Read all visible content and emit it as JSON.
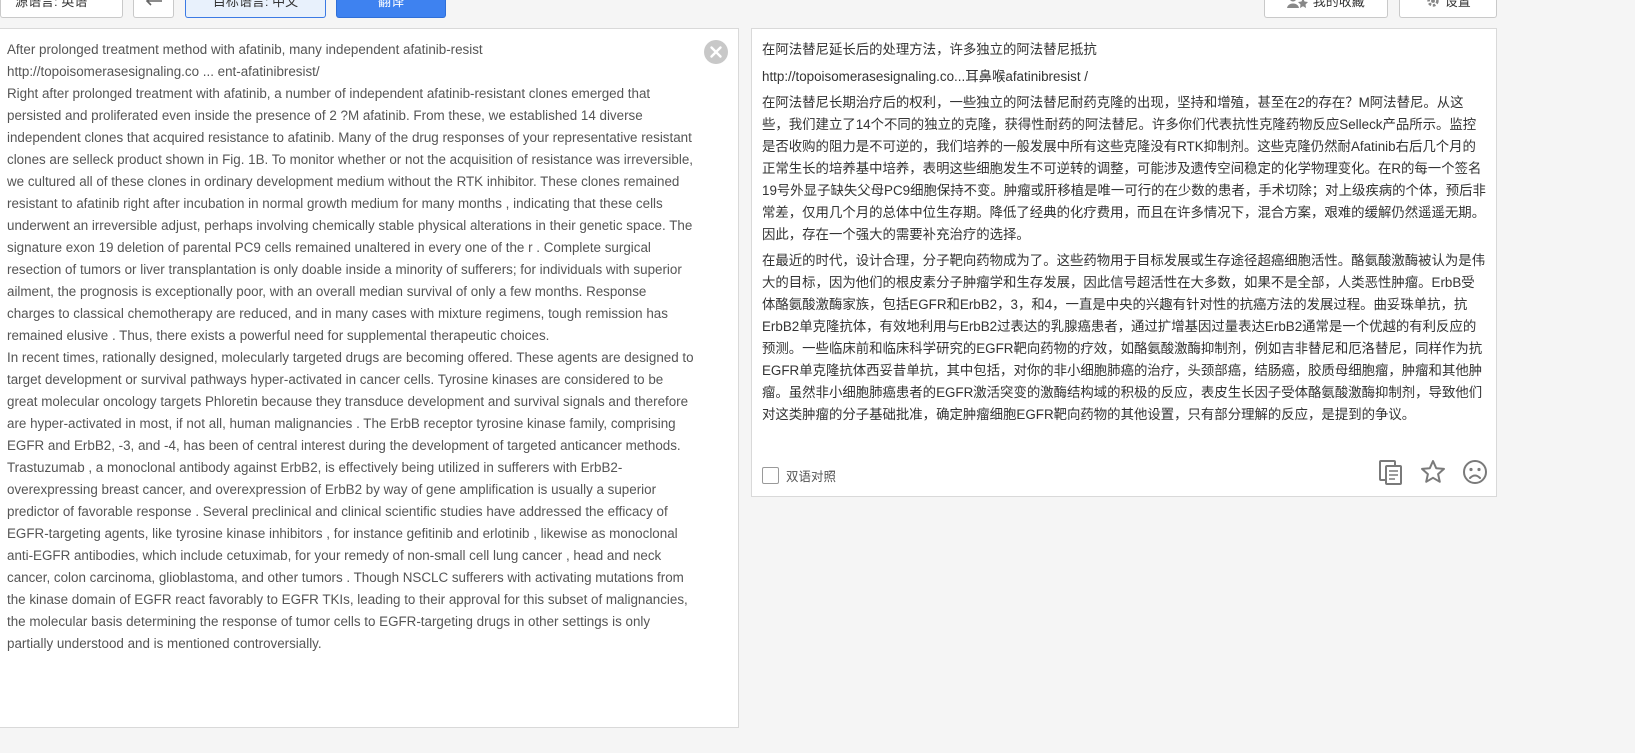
{
  "toolbar": {
    "source_language": "源语言: 英语",
    "target_language": "目标语言: 中文",
    "translate_label": "翻译",
    "favorites_label": "我的收藏",
    "settings_label": "设置"
  },
  "source": {
    "paragraphs": [
      "After prolonged treatment method with afatinib, many independent afatinib-resist",
      "http://topoisomerasesignaling.co ... ent-afatinibresist/",
      "Right after prolonged treatment with afatinib, a number of independent afatinib-resistant clones emerged that persisted and proliferated even inside the presence of 2 ?M afatinib. From these, we established 14 diverse independent clones that acquired resistance to afatinib. Many of the drug responses of your representative resistant clones are selleck product shown in Fig. 1B. To monitor whether or not the acquisition of resistance was irreversible, we cultured all of these clones in ordinary development medium without the RTK inhibitor. These clones remained resistant to afatinib right after incubation in normal growth medium for many months , indicating that these cells underwent an irreversible adjust, perhaps involving chemically stable physical alterations in their genetic space. The signature exon 19 deletion of parental PC9 cells remained unaltered in every one of the r . Complete surgical resection of tumors or liver transplantation is only doable inside a minority of sufferers; for individuals with superior ailment, the prognosis is exceptionally poor, with an overall median survival of only a few months. Response charges to classical chemotherapy are reduced, and in many cases with mixture regimens, tough remission has remained elusive . Thus, there exists a powerful need for supplemental therapeutic choices.",
      "In recent times, rationally designed, molecularly targeted drugs are becoming offered. These agents are designed to target development or survival pathways hyper-activated in cancer cells. Tyrosine kinases are considered to be great molecular oncology targets Phloretin because they transduce development and survival signals and therefore are hyper-activated in most, if not all, human malignancies . The ErbB receptor tyrosine kinase family, comprising EGFR and ErbB2, -3, and -4, has been of central interest during the development of targeted anticancer methods. Trastuzumab , a monoclonal antibody against ErbB2, is effectively being utilized in sufferers with ErbB2-overexpressing breast cancer, and overexpression of ErbB2 by way of gene amplification is usually a superior predictor of favorable response . Several preclinical and clinical scientific studies have addressed the efficacy of EGFR-targeting agents, like tyrosine kinase inhibitors , for instance gefitinib and erlotinib , likewise as monoclonal anti-EGFR antibodies, which include cetuximab, for your remedy of non-small cell lung cancer , head and neck cancer, colon carcinoma, glioblastoma, and other tumors . Though NSCLC sufferers with activating mutations from the kinase domain of EGFR react favorably to EGFR TKIs, leading to their approval for this subset of malignancies, the molecular basis determining the response of tumor cells to EGFR-targeting drugs in other settings is only partially understood and is mentioned controversially."
    ]
  },
  "result": {
    "title": "在阿法替尼延长后的处理方法，许多独立的阿法替尼抵抗",
    "link": "http://topoisomerasesignaling.co...耳鼻喉afatinibresist /",
    "paragraphs": [
      "在阿法替尼长期治疗后的权利，一些独立的阿法替尼耐药克隆的出现，坚持和增殖，甚至在2的存在？M阿法替尼。从这些，我们建立了14个不同的独立的克隆，获得性耐药的阿法替尼。许多你们代表抗性克隆药物反应Selleck产品所示。监控是否收购的阻力是不可逆的，我们培养的一般发展中所有这些克隆没有RTK抑制剂。这些克隆仍然耐Afatinib右后几个月的正常生长的培养基中培养，表明这些细胞发生不可逆转的调整，可能涉及遗传空间稳定的化学物理变化。在R的每一个签名19号外显子缺失父母PC9细胞保持不变。肿瘤或肝移植是唯一可行的在少数的患者，手术切除；对上级疾病的个体，预后非常差，仅用几个月的总体中位生存期。降低了经典的化疗费用，而且在许多情况下，混合方案，艰难的缓解仍然遥遥无期。因此，存在一个强大的需要补充治疗的选择。",
      "在最近的时代，设计合理，分子靶向药物成为了。这些药物用于目标发展或生存途径超癌细胞活性。酪氨酸激酶被认为是伟大的目标，因为他们的根皮素分子肿瘤学和生存发展，因此信号超活性在大多数，如果不是全部，人类恶性肿瘤。ErbB受体酪氨酸激酶家族，包括EGFR和ErbB2，3，和4，一直是中央的兴趣有针对性的抗癌方法的发展过程。曲妥珠单抗，抗ErbB2单克隆抗体，有效地利用与ErbB2过表达的乳腺癌患者，通过扩增基因过量表达ErbB2通常是一个优越的有利反应的预测。一些临床前和临床科学研究的EGFR靶向药物的疗效，如酪氨酸激酶抑制剂，例如吉非替尼和厄洛替尼，同样作为抗EGFR单克隆抗体西妥昔单抗，其中包括，对你的非小细胞肺癌的治疗，头颈部癌，结肠癌，胶质母细胞瘤，肿瘤和其他肿瘤。虽然非小细胞肺癌患者的EGFR激活突变的激酶结构域的积极的反应，表皮生长因子受体酪氨酸激酶抑制剂，导致他们对这类肿瘤的分子基础批准，确定肿瘤细胞EGFR靶向药物的其他设置，只有部分理解的反应，是提到的争议。"
    ],
    "bilingual_label": "双语对照"
  },
  "icons": {
    "swap": "swap-arrow-icon",
    "favorites": "star-list-icon",
    "settings": "gear-icon",
    "clear": "close-icon",
    "copy": "copy-icon",
    "star": "star-icon",
    "feedback": "sad-face-icon"
  },
  "colors": {
    "accent": "#3e82f0",
    "icon": "#7a7a7a"
  }
}
